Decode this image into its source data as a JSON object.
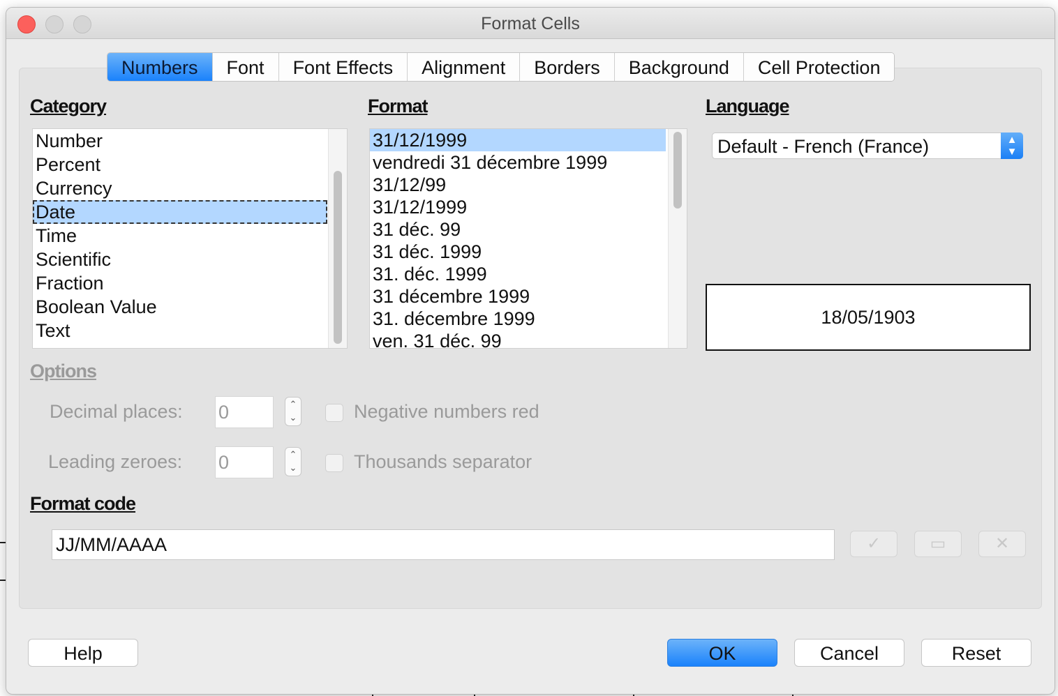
{
  "window": {
    "title": "Format Cells"
  },
  "tabs": [
    {
      "label": "Numbers",
      "active": true
    },
    {
      "label": "Font"
    },
    {
      "label": "Font Effects"
    },
    {
      "label": "Alignment"
    },
    {
      "label": "Borders"
    },
    {
      "label": "Background"
    },
    {
      "label": "Cell Protection"
    }
  ],
  "category": {
    "label": "Category",
    "items": [
      "Number",
      "Percent",
      "Currency",
      "Date",
      "Time",
      "Scientific",
      "Fraction",
      "Boolean Value",
      "Text"
    ],
    "selected": "Date"
  },
  "format": {
    "label": "Format",
    "items": [
      "31/12/1999",
      "vendredi 31 décembre 1999",
      "31/12/99",
      "31/12/1999",
      "31 déc. 99",
      "31 déc. 1999",
      "31. déc. 1999",
      "31 décembre 1999",
      "31. décembre 1999",
      "ven. 31 déc. 99"
    ],
    "selected_index": 0
  },
  "language": {
    "label": "Language",
    "value": "Default - French (France)"
  },
  "preview": {
    "value": "18/05/1903"
  },
  "options": {
    "label": "Options",
    "decimal_places_label": "Decimal places:",
    "decimal_places_value": "0",
    "leading_zeroes_label": "Leading zeroes:",
    "leading_zeroes_value": "0",
    "negative_red_label": "Negative numbers red",
    "thousands_label": "Thousands separator"
  },
  "format_code": {
    "label": "Format code",
    "value": "JJ/MM/AAAA"
  },
  "buttons": {
    "help": "Help",
    "ok": "OK",
    "cancel": "Cancel",
    "reset": "Reset"
  },
  "colors": {
    "accent": "#1a82fb",
    "selection": "#b3d7ff",
    "close": "#fc605c"
  }
}
